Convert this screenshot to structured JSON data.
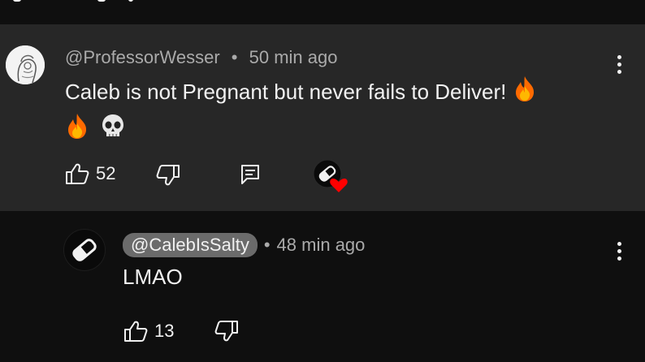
{
  "comments": [
    {
      "handle": "@ProfessorWesser",
      "separator": "•",
      "time": "50 min ago",
      "text_line1": "Caleb is not Pregnant but never fails to Deliver!",
      "likes": "52",
      "icons": [
        "thumbs-up-icon",
        "thumbs-down-icon",
        "reply-icon",
        "creator-heart-icon",
        "more-vertical-icon"
      ]
    }
  ],
  "reply": {
    "handle": "@CalebIsSalty",
    "separator": "•",
    "time": "48 min ago",
    "text": "LMAO",
    "likes": "13",
    "icons": [
      "thumbs-up-icon",
      "thumbs-down-icon",
      "more-vertical-icon"
    ]
  },
  "colors": {
    "background": "#0f0f0f",
    "highlighted_comment": "#272727",
    "text_primary": "#f1f1f1",
    "text_secondary": "#aaaaaa",
    "handle_chip": "#6b6b6b",
    "heart": "#ff0000"
  }
}
